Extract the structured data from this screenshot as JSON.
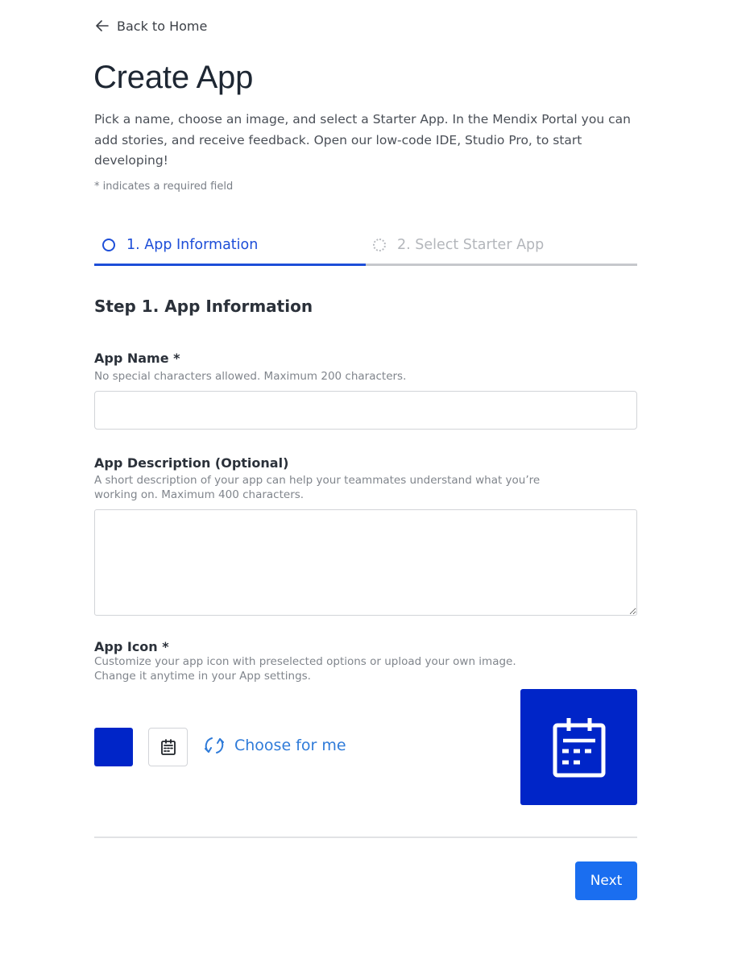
{
  "nav": {
    "back_label": "Back to Home"
  },
  "header": {
    "title": "Create App",
    "intro": "Pick a name, choose an image, and select a Starter App. In the Mendix Portal you can add stories, and receive feedback. Open our low-code IDE, Studio Pro, to start developing!",
    "required_note": "* indicates a required field"
  },
  "stepper": {
    "steps": [
      {
        "label": "1. App Information",
        "state": "active"
      },
      {
        "label": "2. Select Starter App",
        "state": "pending"
      }
    ],
    "progress_fraction": 0.5
  },
  "form": {
    "section_title": "Step 1. App Information",
    "app_name": {
      "label": "App Name *",
      "hint": "No special characters allowed. Maximum 200 characters.",
      "value": "",
      "placeholder": ""
    },
    "app_description": {
      "label": "App Description (Optional)",
      "hint_line1": "A short description of your app can help your teammates understand what you’re",
      "hint_line2": "working on. Maximum 400 characters.",
      "value": "",
      "placeholder": ""
    },
    "app_icon": {
      "label": "App Icon *",
      "hint_line1": "Customize your app icon with preselected options or upload your own image.",
      "hint_line2": "Change it anytime in your App settings.",
      "selected_color": "#0025c8",
      "selected_icon": "calendar-icon",
      "choose_label": "Choose for me"
    }
  },
  "footer": {
    "next_label": "Next"
  },
  "colors": {
    "accent": "#1d4ed8",
    "primary_button": "#1a6ef0",
    "link": "#2f7bd9",
    "icon_background": "#0025c8"
  }
}
